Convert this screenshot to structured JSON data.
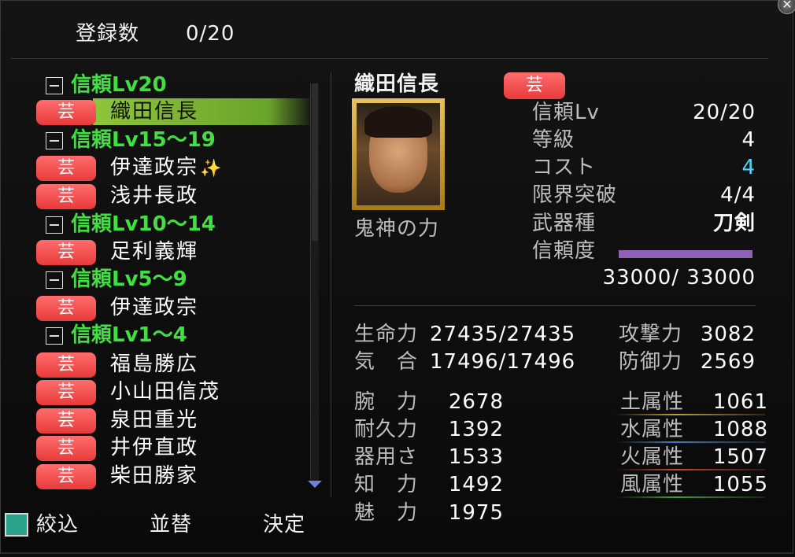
{
  "header": {
    "count_label": "登録数",
    "count_value": "0/20"
  },
  "list": {
    "groups": [
      {
        "label": "信頼Lv20"
      },
      {
        "label": "信頼Lv15～19"
      },
      {
        "label": "信頼Lv10～14"
      },
      {
        "label": "信頼Lv5～9"
      },
      {
        "label": "信頼Lv1～4"
      }
    ],
    "badge_label": "芸",
    "items": [
      {
        "name": "織田信長"
      },
      {
        "name": "伊達政宗"
      },
      {
        "name": "浅井長政"
      },
      {
        "name": "足利義輝"
      },
      {
        "name": "伊達政宗"
      },
      {
        "name": "福島勝広"
      },
      {
        "name": "小山田信茂"
      },
      {
        "name": "泉田重光"
      },
      {
        "name": "井伊直政"
      },
      {
        "name": "柴田勝家"
      }
    ],
    "sparkle_icon": "sparkle-icon"
  },
  "detail": {
    "name": "織田信長",
    "badge": "芸",
    "skill": "鬼神の力",
    "stats": [
      {
        "label": "信頼Lv",
        "value": "20/20"
      },
      {
        "label": "等級",
        "value": "4"
      },
      {
        "label": "コスト",
        "value": "4"
      },
      {
        "label": "限界突破",
        "value": "4/4"
      },
      {
        "label": "武器種",
        "value": "刀剣"
      },
      {
        "label": "信頼度",
        "value": ""
      }
    ],
    "trust_value": "33000/ 33000",
    "trust_fill": 1.0,
    "hp_label": "生命力",
    "hp_value": "27435/27435",
    "ki_label": "気　合",
    "ki_value": "17496/17496",
    "atk_label": "攻撃力",
    "atk_value": "3082",
    "def_label": "防御力",
    "def_value": "2569",
    "attributes": [
      {
        "label": "腕　力",
        "value": "2678"
      },
      {
        "label": "耐久力",
        "value": "1392"
      },
      {
        "label": "器用さ",
        "value": "1533"
      },
      {
        "label": "知　力",
        "value": "1492"
      },
      {
        "label": "魅　力",
        "value": "1975"
      }
    ],
    "elements": [
      {
        "label": "土属性",
        "value": "1061",
        "color": "#c79a2c"
      },
      {
        "label": "水属性",
        "value": "1088",
        "color": "#3a7fc4"
      },
      {
        "label": "火属性",
        "value": "1507",
        "color": "#c44a3a"
      },
      {
        "label": "風属性",
        "value": "1055",
        "color": "#4a9a3a"
      }
    ]
  },
  "footer": {
    "filter": "絞込",
    "sort": "並替",
    "confirm": "決定"
  },
  "colors": {
    "cost_value": "#4fd6ff",
    "group_label": "#3fe03f",
    "badge": "#e83a3a",
    "selection": "#8fc53a"
  }
}
